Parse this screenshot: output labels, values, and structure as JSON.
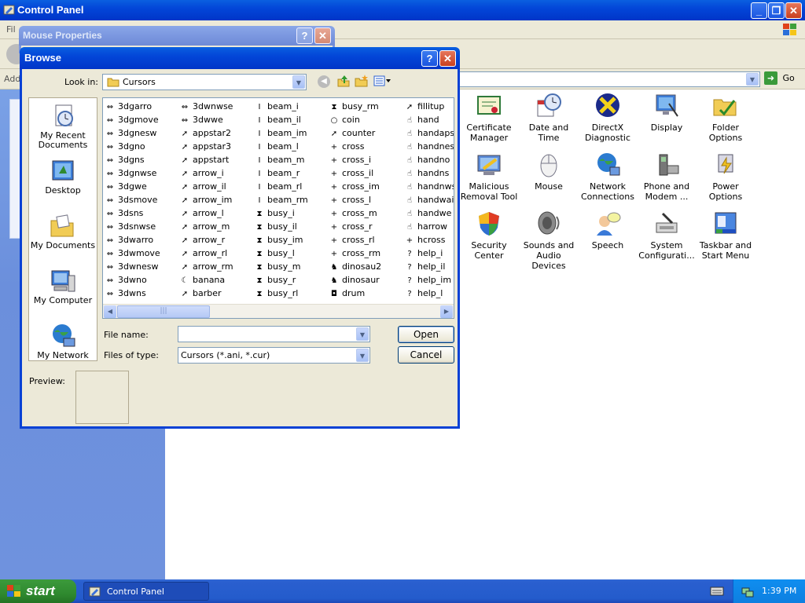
{
  "control_panel": {
    "title": "Control Panel",
    "menu_fragment": "Fil",
    "address_fragment": "Add",
    "go_label": "Go",
    "items": [
      {
        "label": "Certificate Manager",
        "icon": "certificate-icon"
      },
      {
        "label": "Date and Time",
        "icon": "clock-calendar-icon"
      },
      {
        "label": "DirectX Diagnostic",
        "icon": "directx-icon"
      },
      {
        "label": "Display",
        "icon": "display-icon"
      },
      {
        "label": "Folder Options",
        "icon": "folder-options-icon"
      },
      {
        "label": "Malicious Removal Tool",
        "icon": "removal-tool-icon"
      },
      {
        "label": "Mouse",
        "icon": "mouse-icon"
      },
      {
        "label": "Network Connections",
        "icon": "network-icon"
      },
      {
        "label": "Phone and Modem ...",
        "icon": "phone-modem-icon"
      },
      {
        "label": "Power Options",
        "icon": "power-icon"
      },
      {
        "label": "Security Center",
        "icon": "shield-icon"
      },
      {
        "label": "Sounds and Audio Devices",
        "icon": "speaker-icon"
      },
      {
        "label": "Speech",
        "icon": "speech-icon"
      },
      {
        "label": "System Configurati...",
        "icon": "system-config-icon"
      },
      {
        "label": "Taskbar and Start Menu",
        "icon": "taskbar-icon"
      }
    ]
  },
  "mouse_properties": {
    "title": "Mouse Properties"
  },
  "browse": {
    "title": "Browse",
    "look_in_label": "Look in:",
    "look_in_value": "Cursors",
    "places": [
      "My Recent Documents",
      "Desktop",
      "My Documents",
      "My Computer",
      "My Network"
    ],
    "file_name_label": "File name:",
    "file_name_value": "",
    "files_of_type_label": "Files of type:",
    "files_of_type_value": "Cursors (*.ani, *.cur)",
    "open_label": "Open",
    "cancel_label": "Cancel",
    "preview_label": "Preview:",
    "files": [
      [
        "3dgarro",
        "3dgmove",
        "3dgnesw",
        "3dgno",
        "3dgns",
        "3dgnwse",
        "3dgwe",
        "3dsmove",
        "3dsns",
        "3dsnwse",
        "3dwarro",
        "3dwmove",
        "3dwnesw",
        "3dwno",
        "3dwns"
      ],
      [
        "3dwnwse",
        "3dwwe",
        "appstar2",
        "appstar3",
        "appstart",
        "arrow_i",
        "arrow_il",
        "arrow_im",
        "arrow_l",
        "arrow_m",
        "arrow_r",
        "arrow_rl",
        "arrow_rm",
        "banana",
        "barber"
      ],
      [
        "beam_i",
        "beam_il",
        "beam_im",
        "beam_l",
        "beam_m",
        "beam_r",
        "beam_rl",
        "beam_rm",
        "busy_i",
        "busy_il",
        "busy_im",
        "busy_l",
        "busy_m",
        "busy_r",
        "busy_rl"
      ],
      [
        "busy_rm",
        "coin",
        "counter",
        "cross",
        "cross_i",
        "cross_il",
        "cross_im",
        "cross_l",
        "cross_m",
        "cross_r",
        "cross_rl",
        "cross_rm",
        "dinosau2",
        "dinosaur",
        "drum"
      ],
      [
        "fillitup",
        "hand",
        "handapst",
        "handnesw",
        "handno",
        "handns",
        "handnwse",
        "handwait",
        "handwe",
        "harrow",
        "hcross",
        "help_i",
        "help_il",
        "help_im",
        "help_l"
      ]
    ]
  },
  "taskbar": {
    "start_label": "start",
    "task_label": "Control Panel",
    "clock": "1:39 PM"
  }
}
